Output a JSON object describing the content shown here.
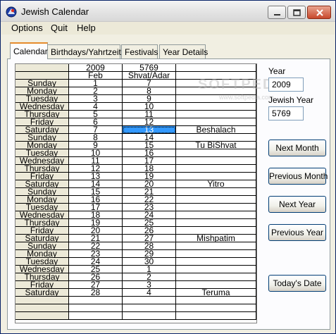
{
  "window": {
    "title": "Jewish Calendar",
    "accent_color": "#0a246a",
    "watermark": "SOFTPEDIA",
    "watermark_url": "www.softpedia.com"
  },
  "menu": [
    "Options",
    "Quit",
    "Help"
  ],
  "tabs": [
    "Calendar",
    "Birthdays/Yahrtzeits",
    "Festivals",
    "Year Details"
  ],
  "grid": {
    "year_header": [
      "",
      "2009",
      "5769",
      ""
    ],
    "month_header": [
      "",
      "Feb",
      "Shvat/Adar",
      ""
    ],
    "selected_row": 6,
    "selection_color": "#3399ff",
    "rows": [
      [
        "Sunday",
        "1",
        "7",
        ""
      ],
      [
        "Monday",
        "2",
        "8",
        ""
      ],
      [
        "Tuesday",
        "3",
        "9",
        ""
      ],
      [
        "Wednesday",
        "4",
        "10",
        ""
      ],
      [
        "Thursday",
        "5",
        "11",
        ""
      ],
      [
        "Friday",
        "6",
        "12",
        ""
      ],
      [
        "Saturday",
        "7",
        "13",
        "Beshalach"
      ],
      [
        "Sunday",
        "8",
        "14",
        ""
      ],
      [
        "Monday",
        "9",
        "15",
        "Tu BiShvat"
      ],
      [
        "Tuesday",
        "10",
        "16",
        ""
      ],
      [
        "Wednesday",
        "11",
        "17",
        ""
      ],
      [
        "Thursday",
        "12",
        "18",
        ""
      ],
      [
        "Friday",
        "13",
        "19",
        ""
      ],
      [
        "Saturday",
        "14",
        "20",
        "Yitro"
      ],
      [
        "Sunday",
        "15",
        "21",
        ""
      ],
      [
        "Monday",
        "16",
        "22",
        ""
      ],
      [
        "Tuesday",
        "17",
        "23",
        ""
      ],
      [
        "Wednesday",
        "18",
        "24",
        ""
      ],
      [
        "Thursday",
        "19",
        "25",
        ""
      ],
      [
        "Friday",
        "20",
        "26",
        ""
      ],
      [
        "Saturday",
        "21",
        "27",
        "Mishpatim"
      ],
      [
        "Sunday",
        "22",
        "28",
        ""
      ],
      [
        "Monday",
        "23",
        "29",
        ""
      ],
      [
        "Tuesday",
        "24",
        "30",
        ""
      ],
      [
        "Wednesday",
        "25",
        "1",
        ""
      ],
      [
        "Thursday",
        "26",
        "2",
        ""
      ],
      [
        "Friday",
        "27",
        "3",
        ""
      ],
      [
        "Saturday",
        "28",
        "4",
        "Teruma"
      ],
      [
        "",
        "",
        "",
        ""
      ],
      [
        "",
        "",
        "",
        ""
      ],
      [
        "",
        "",
        "",
        ""
      ]
    ]
  },
  "side": {
    "year_label": "Year",
    "year_value": "2009",
    "jewish_year_label": "Jewish Year",
    "jewish_year_value": "5769",
    "buttons": [
      "Next Month",
      "Previous Month",
      "Next Year",
      "Previous Year",
      "Today's Date"
    ]
  }
}
